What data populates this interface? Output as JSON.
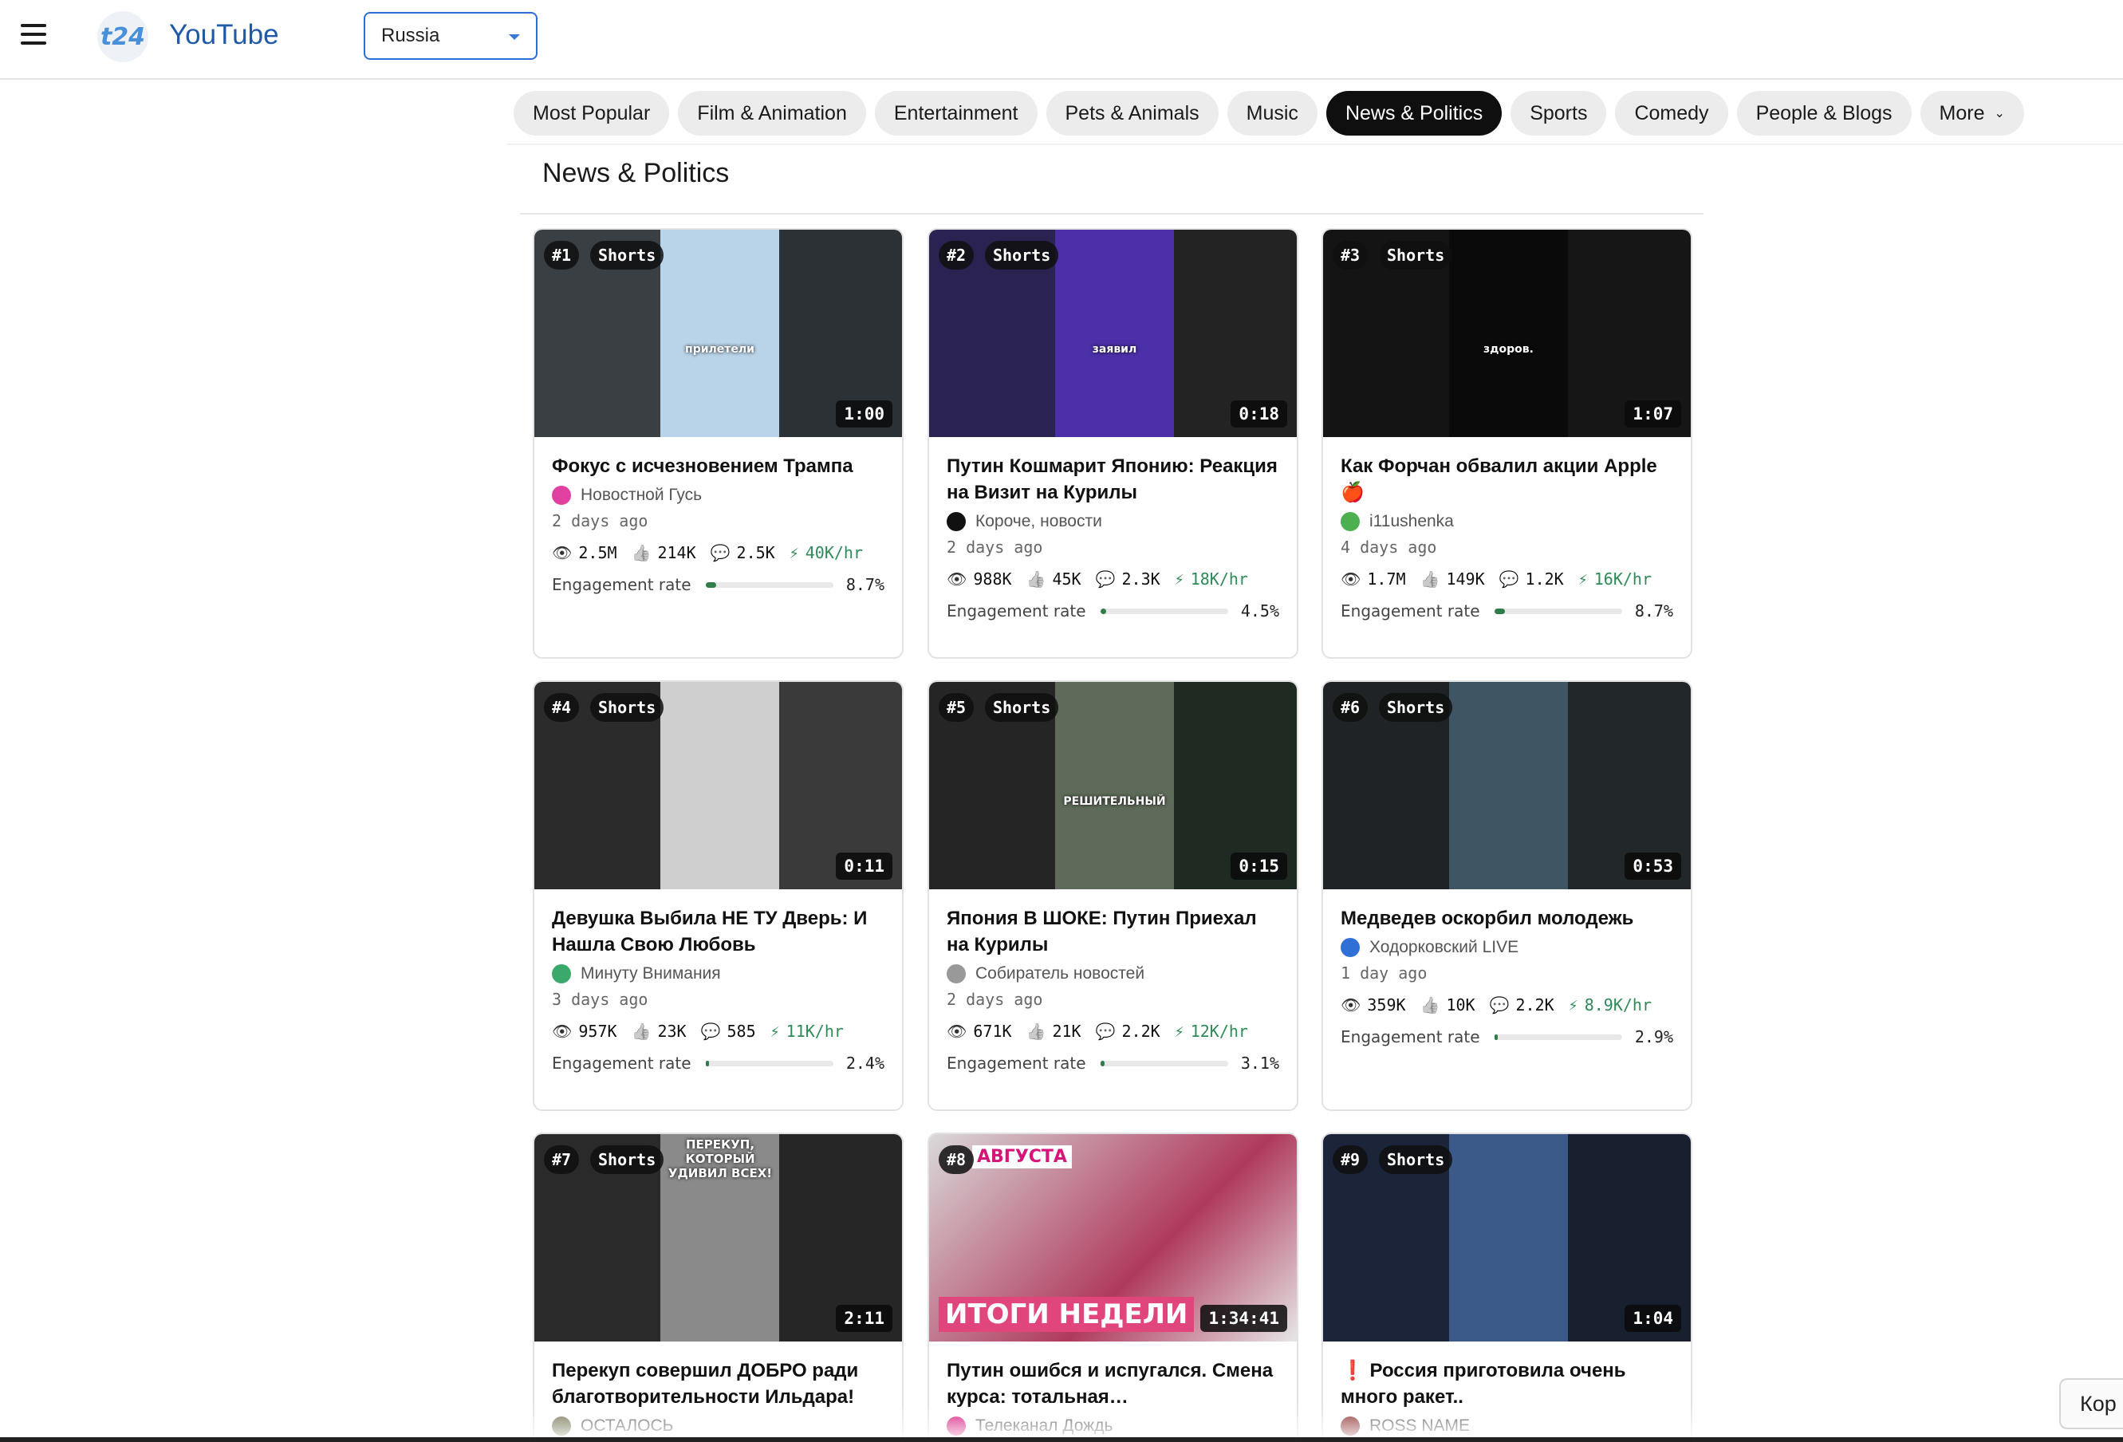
{
  "header": {
    "logo_badge": "t24",
    "logo_text": "YouTube",
    "region": "Russia"
  },
  "categories": [
    {
      "label": "Most Popular",
      "active": false
    },
    {
      "label": "Film & Animation",
      "active": false
    },
    {
      "label": "Entertainment",
      "active": false
    },
    {
      "label": "Pets & Animals",
      "active": false
    },
    {
      "label": "Music",
      "active": false
    },
    {
      "label": "News & Politics",
      "active": true
    },
    {
      "label": "Sports",
      "active": false
    },
    {
      "label": "Comedy",
      "active": false
    },
    {
      "label": "People & Blogs",
      "active": false
    },
    {
      "label": "More",
      "active": false
    }
  ],
  "section_title": "News & Politics",
  "engagement_label": "Engagement rate",
  "videos": [
    {
      "rank": "#1",
      "shorts": "Shorts",
      "duration": "1:00",
      "overlay": "прилетели",
      "title": "Фокус с исчезновением Трампа",
      "channel": "Новостной Гусь",
      "channel_color": "#e040a0",
      "ago": "2 days ago",
      "views": "2.5M",
      "likes": "214K",
      "comments": "2.5K",
      "rate": "40K/hr",
      "engagement": "8.7%",
      "engagement_value": 8.7,
      "thumb_colors": [
        "#3a3f44",
        "#b9d3e8",
        "#2c3136"
      ]
    },
    {
      "rank": "#2",
      "shorts": "Shorts",
      "duration": "0:18",
      "overlay": "заявил",
      "title": "Путин Кошмарит Японию: Реакция на Визит на Курилы",
      "channel": "Короче, новости",
      "channel_color": "#111111",
      "ago": "2 days ago",
      "views": "988K",
      "likes": "45K",
      "comments": "2.3K",
      "rate": "18K/hr",
      "engagement": "4.5%",
      "engagement_value": 4.5,
      "thumb_colors": [
        "#2a2250",
        "#4a2fa8",
        "#232323"
      ]
    },
    {
      "rank": "#3",
      "shorts": "Shorts",
      "duration": "1:07",
      "overlay": "здоров.",
      "title": "Как Форчан обвалил акции Apple 🍎",
      "channel": "i11ushenka",
      "channel_color": "#4caf50",
      "ago": "4 days ago",
      "views": "1.7M",
      "likes": "149K",
      "comments": "1.2K",
      "rate": "16K/hr",
      "engagement": "8.7%",
      "engagement_value": 8.7,
      "thumb_colors": [
        "#141414",
        "#0a0a0a",
        "#161616"
      ]
    },
    {
      "rank": "#4",
      "shorts": "Shorts",
      "duration": "0:11",
      "overlay": "",
      "title": "Девушка Выбила НЕ ТУ Дверь: И Нашла Свою Любовь",
      "channel": "Минуту Внимания",
      "channel_color": "#3aa96b",
      "ago": "3 days ago",
      "views": "957K",
      "likes": "23K",
      "comments": "585",
      "rate": "11K/hr",
      "engagement": "2.4%",
      "engagement_value": 2.4,
      "thumb_colors": [
        "#2b2b2b",
        "#cfcfcf",
        "#3a3a3a"
      ]
    },
    {
      "rank": "#5",
      "shorts": "Shorts",
      "duration": "0:15",
      "overlay": "РЕШИТЕЛЬНЫЙ",
      "title": "Япония В ШОКЕ: Путин Приехал на Курилы",
      "channel": "Собиратель новостей",
      "channel_color": "#999999",
      "ago": "2 days ago",
      "views": "671K",
      "likes": "21K",
      "comments": "2.2K",
      "rate": "12K/hr",
      "engagement": "3.1%",
      "engagement_value": 3.1,
      "thumb_colors": [
        "#252525",
        "#5e6b5a",
        "#1e2a22"
      ]
    },
    {
      "rank": "#6",
      "shorts": "Shorts",
      "duration": "0:53",
      "overlay": "",
      "title": "Медведев оскорбил молодежь",
      "channel": "Ходорковский LIVE",
      "channel_color": "#2f6fd6",
      "ago": "1 day ago",
      "views": "359K",
      "likes": "10K",
      "comments": "2.2K",
      "rate": "8.9K/hr",
      "engagement": "2.9%",
      "engagement_value": 2.9,
      "thumb_colors": [
        "#1f2326",
        "#3f5563",
        "#22272a"
      ]
    },
    {
      "rank": "#7",
      "shorts": "Shorts",
      "duration": "2:11",
      "overlay": "ПЕРЕКУП, КОТОРЫЙ УДИВИЛ ВСЕХ!",
      "title": "Перекуп совершил ДОБРО ради благотворительности Ильдара!",
      "channel": "ОСТАЛОСЬ",
      "channel_color": "#6b6b4a",
      "ago": "",
      "views": "",
      "likes": "",
      "comments": "",
      "rate": "",
      "engagement": "",
      "engagement_value": 0,
      "thumb_colors": [
        "#2a2a2a",
        "#8a8a8a",
        "#262626"
      ]
    },
    {
      "rank": "#8",
      "shorts": "",
      "duration": "1:34:41",
      "overlay": "ИТОГИ НЕДЕЛИ",
      "title": "Путин ошибся и испугался. Смена курса: тотальная…",
      "channel": "Телеканал Дождь",
      "channel_color": "#d6157a",
      "ago": "",
      "views": "",
      "likes": "",
      "comments": "",
      "rate": "",
      "engagement": "",
      "engagement_value": 0,
      "thumb_colors": [
        "#d9d9d9",
        "#b03a5e",
        "#e6e6e6"
      ]
    },
    {
      "rank": "#9",
      "shorts": "Shorts",
      "duration": "1:04",
      "overlay": "",
      "title": "❗ Россия приготовила очень много ракет..",
      "channel": "ROSS NAME",
      "channel_color": "#8a2a2a",
      "ago": "",
      "views": "",
      "likes": "",
      "comments": "",
      "rate": "",
      "engagement": "",
      "engagement_value": 0,
      "thumb_colors": [
        "#1b2438",
        "#3b5a8a",
        "#182030"
      ]
    }
  ],
  "extra_overlay": {
    "card8_tag": "АВГУСТА"
  },
  "floating_button": "Кор"
}
